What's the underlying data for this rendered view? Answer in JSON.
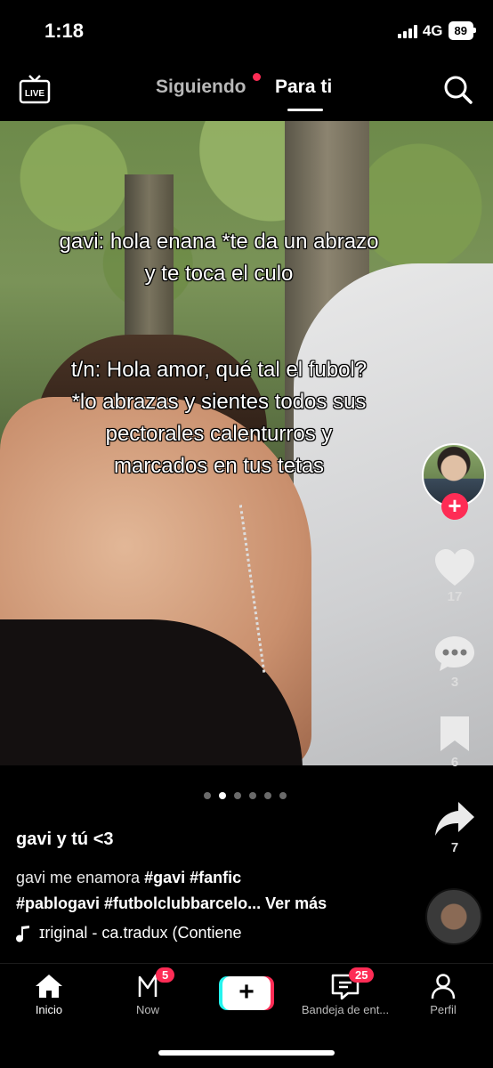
{
  "status_bar": {
    "time": "1:18",
    "network": "4G",
    "battery": "89"
  },
  "top_nav": {
    "live_label": "LIVE",
    "following_label": "Siguiendo",
    "foryou_label": "Para ti"
  },
  "video": {
    "overlay_line1": "gavi: hola enana *te da un abrazo y te toca el culo",
    "overlay_line2": "t/n: Hola amor, qué tal el fubol? *lo abrazas y sientes todos sus pectorales calenturros y marcados en tus tetas",
    "slide_count": 6,
    "active_slide": 2
  },
  "actions": {
    "likes": "17",
    "comments": "3",
    "saves": "6",
    "shares": "7"
  },
  "caption": {
    "username": "gavi y tú <3",
    "text": "gavi me enamora ",
    "tags": [
      "#gavi",
      "#fanfic",
      "#pablogavi",
      "#futbolclubbarcelo..."
    ],
    "more": "Ver más",
    "music": "ɪriginal - ca.tradux (Contiene"
  },
  "tabbar": {
    "home": "Inicio",
    "now": "Now",
    "now_badge": "5",
    "inbox": "Bandeja de ent...",
    "inbox_badge": "25",
    "profile": "Perfil",
    "create": "+"
  },
  "colors": {
    "accent_red": "#fe2c55",
    "accent_cyan": "#25f4ee",
    "background": "#000000"
  }
}
